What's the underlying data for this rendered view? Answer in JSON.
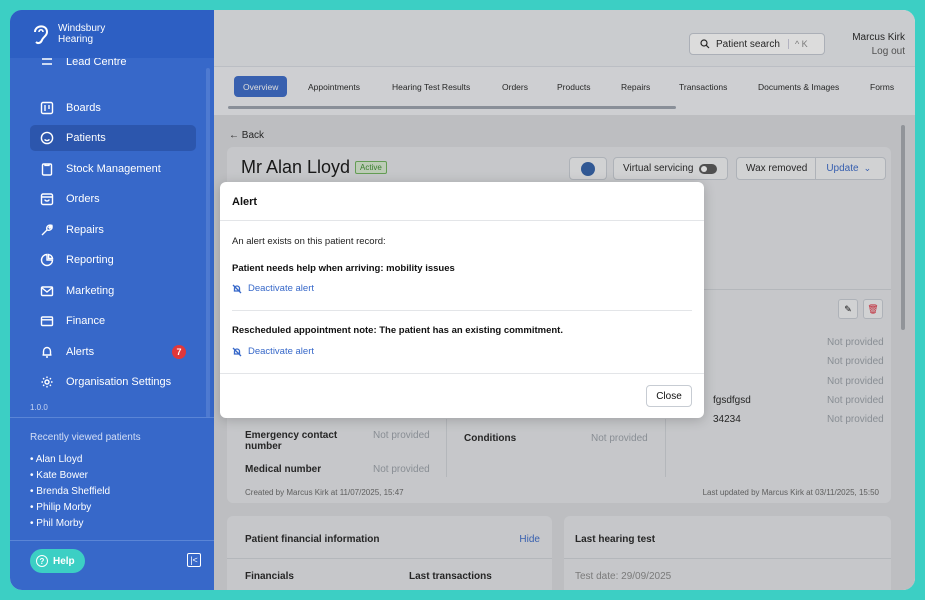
{
  "brand": {
    "line1": "Windsbury",
    "line2": "Hearing"
  },
  "sidebar": {
    "partial_item": "Lead Centre",
    "items": [
      {
        "label": "Boards",
        "icon": "boards-icon"
      },
      {
        "label": "Patients",
        "icon": "patients-icon",
        "active": true
      },
      {
        "label": "Stock Management",
        "icon": "clipboard-icon"
      },
      {
        "label": "Orders",
        "icon": "orders-icon"
      },
      {
        "label": "Repairs",
        "icon": "wrench-icon"
      },
      {
        "label": "Reporting",
        "icon": "pie-chart-icon"
      },
      {
        "label": "Marketing",
        "icon": "mail-icon"
      },
      {
        "label": "Finance",
        "icon": "card-icon"
      },
      {
        "label": "Alerts",
        "icon": "bell-icon",
        "badge": "7"
      },
      {
        "label": "Organisation Settings",
        "icon": "gear-icon"
      }
    ],
    "version": "1.0.0",
    "recent_title": "Recently viewed patients",
    "recent": [
      "• Alan Lloyd",
      "• Kate Bower",
      "• Brenda Sheffield",
      "• Philip Morby",
      "• Phil Morby"
    ],
    "help_label": "Help"
  },
  "header": {
    "search_label": "Patient search",
    "search_shortcut": "^ K",
    "user_name": "Marcus Kirk",
    "logout": "Log out"
  },
  "tabs": [
    "Overview",
    "Appointments",
    "Hearing Test Results",
    "Orders",
    "Products",
    "Repairs",
    "Transactions",
    "Documents & Images",
    "Forms"
  ],
  "patient": {
    "back": "Back",
    "name": "Mr Alan Lloyd",
    "status": "Active",
    "virtual_servicing": "Virtual servicing",
    "wax": "Wax removed",
    "update": "Update",
    "not_provided": "Not provided",
    "partial_val1": "fgsdfgsd",
    "partial_val2": "34234",
    "emergency_label_1": "Emergency contact",
    "emergency_label_2": "number",
    "medical_label": "Medical number",
    "conditions_label": "Conditions",
    "created": "Created by Marcus Kirk at 11/07/2025, 15:47",
    "updated": "Last updated by Marcus Kirk at 03/11/2025, 15:50"
  },
  "financial": {
    "title": "Patient financial information",
    "hide": "Hide",
    "col1": "Financials",
    "col2": "Last transactions"
  },
  "hearing": {
    "title": "Last hearing test",
    "date": "Test date: 29/09/2025"
  },
  "modal": {
    "title": "Alert",
    "intro": "An alert exists on this patient record:",
    "alerts": [
      {
        "text": "Patient needs help when arriving: mobility issues",
        "action": "Deactivate alert"
      },
      {
        "text": "Rescheduled appointment note: The patient has an existing commitment.",
        "action": "Deactivate alert"
      }
    ],
    "close": "Close"
  }
}
